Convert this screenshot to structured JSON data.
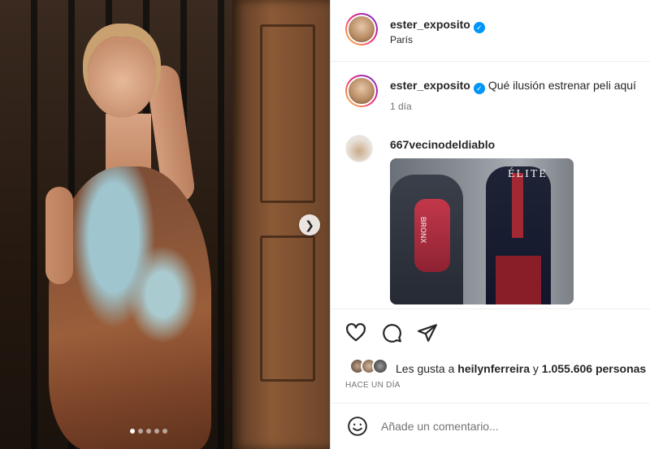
{
  "post": {
    "author": "ester_exposito",
    "location": "París",
    "caption_text": "Qué ilusión estrenar peli aquí",
    "caption_time": "1 día",
    "carousel": {
      "slide_count": 5,
      "active_index": 0
    }
  },
  "comment": {
    "author": "667vecinodeldiablo",
    "gif_overlay_text": "ÉLITE",
    "gif_backpack_text": "BRONX"
  },
  "likes": {
    "prefix": "Les gusta a ",
    "user": "heilynferreira",
    "middle": " y ",
    "count": "1.055.606 personas"
  },
  "date_label": "HACE UN DÍA",
  "comment_input": {
    "placeholder": "Añade un comentario..."
  },
  "icons": {
    "verified": "verified-badge-icon",
    "carousel_next": "chevron-right-icon",
    "like": "heart-icon",
    "comment": "comment-bubble-icon",
    "share": "paper-plane-icon",
    "emoji": "emoji-icon"
  },
  "colors": {
    "accent": "#0095f6",
    "text": "#262626",
    "muted": "#737373"
  }
}
